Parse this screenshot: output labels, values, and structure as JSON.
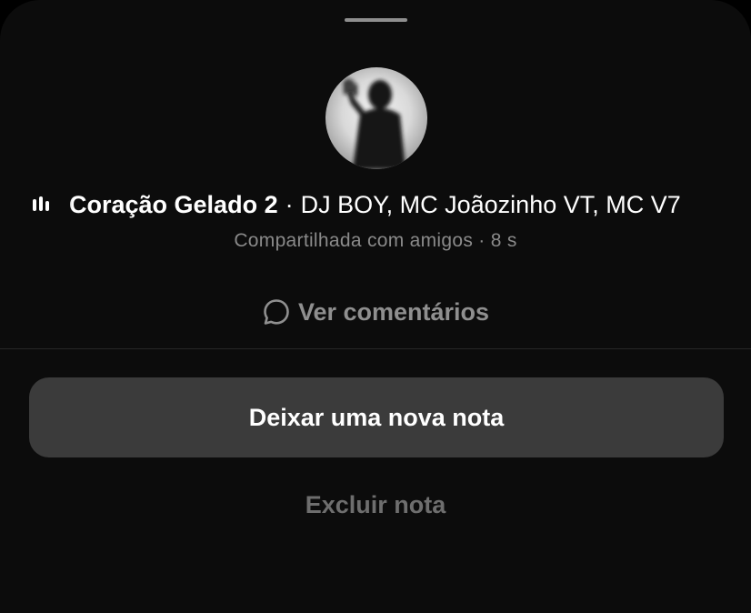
{
  "note": {
    "song_title": "Coração Gelado 2",
    "separator": "·",
    "artists": "DJ BOY, MC Joãozinho VT, MC V7",
    "shared_status": "Compartilhada com amigos · 8 s"
  },
  "actions": {
    "view_comments": "Ver comentários",
    "new_note": "Deixar uma nova nota",
    "delete_note": "Excluir nota"
  },
  "icons": {
    "playing": "equalizer-icon",
    "comments": "speech-bubble-icon"
  },
  "colors": {
    "background": "#0c0c0c",
    "primary_button": "#3b3b3b",
    "muted_text": "#8a8a8a"
  }
}
